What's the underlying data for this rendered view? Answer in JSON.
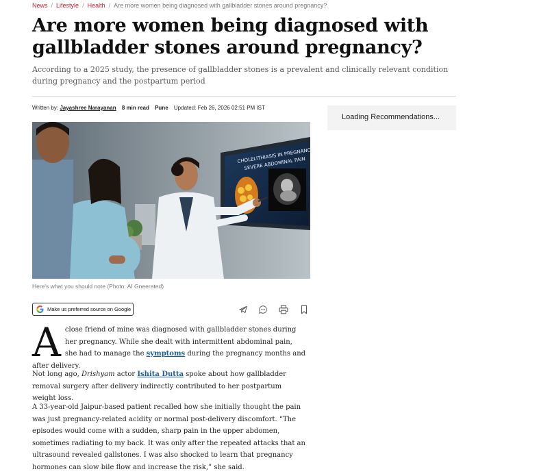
{
  "breadcrumb": {
    "items": [
      "News",
      "Lifestyle",
      "Health"
    ],
    "current": "Are more women being diagnosed with gallbladder stones around pregnancy?"
  },
  "headline": "Are more women being diagnosed with gallbladder stones around pregnancy?",
  "subheadline": "According to a 2025 study, the presence of gallbladder stones is a prevalent and clinically relevant condition during pregnancy and the postpartum period",
  "byline": {
    "written_by": "Written by:",
    "author": "Jayashree Narayanan",
    "read_time": "8 min read",
    "location": "Pune",
    "updated": "Updated: Feb 26, 2026 02:51 PM IST"
  },
  "recommendations": {
    "loading_text": "Loading Recommendations..."
  },
  "hero": {
    "screen_text_line1": "CHOLELITHIASIS IN PREGNANCY:",
    "screen_text_line2": "SEVERE ABDOMINAL PAIN",
    "caption": "Here's what you should note (Photo: AI Gneerated)"
  },
  "google_button": {
    "label": "Make us preferred source on Google"
  },
  "share_icons": [
    "telegram-icon",
    "comment-icon",
    "print-icon",
    "bookmark-icon"
  ],
  "article": {
    "p1": {
      "dropcap": "A",
      "text_before": "close friend of mine was diagnosed with gallbladder stones during her pregnancy. While she dealt with intermittent abdominal pain, she had to manage the ",
      "link": "symptoms",
      "text_after": " during the pregnancy months and after delivery."
    },
    "p2": {
      "text_before": "Not long ago, ",
      "italic": "Drishyam",
      "text_mid": " actor ",
      "link": "Ishita Dutta",
      "text_after": " spoke about how gallbladder removal surgery after delivery indirectly contributed to her postpartum weight loss."
    },
    "p3": "A 33-year-old Jaipur-based patient recalled how she initially thought the pain was just pregnancy-related acidity or normal post-delivery discomfort. “The episodes would come with a sudden, sharp pain in the upper abdomen, sometimes radiating to my back. It was only after the repeated attacks that an ultrasound revealed gallstones. I was also shocked to learn that pregnancy hormones can slow bile flow and increase the risk,” she said."
  }
}
